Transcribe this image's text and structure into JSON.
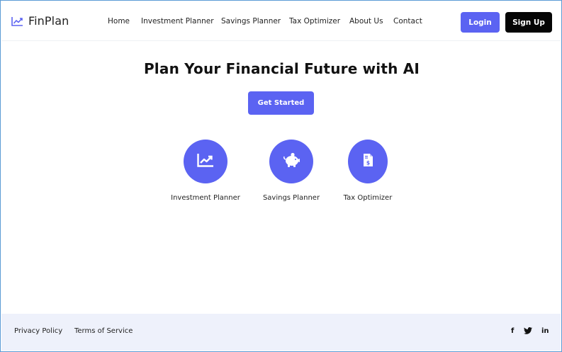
{
  "brand": {
    "name": "FinPlan",
    "logo_icon": "trend-chart-icon"
  },
  "nav": {
    "links": [
      "Home",
      "Investment Planner",
      "Savings Planner",
      "Tax Optimizer",
      "About Us",
      "Contact"
    ],
    "login_label": "Login",
    "signup_label": "Sign Up"
  },
  "hero": {
    "title": "Plan Your Financial Future with AI",
    "cta_label": "Get Started"
  },
  "features": [
    {
      "label": "Investment Planner",
      "icon": "chart-line-icon"
    },
    {
      "label": "Savings Planner",
      "icon": "piggy-bank-icon"
    },
    {
      "label": "Tax Optimizer",
      "icon": "invoice-dollar-icon"
    }
  ],
  "footer": {
    "links": [
      "Privacy Policy",
      "Terms of Service"
    ],
    "social": [
      {
        "name": "facebook-icon",
        "glyph": "f"
      },
      {
        "name": "twitter-icon",
        "glyph": ""
      },
      {
        "name": "linkedin-icon",
        "glyph": "in"
      }
    ]
  },
  "colors": {
    "accent": "#5b63f2",
    "dark_button": "#050505",
    "footer_bg": "#eef1fb",
    "frame_border": "#5b9bd5"
  }
}
